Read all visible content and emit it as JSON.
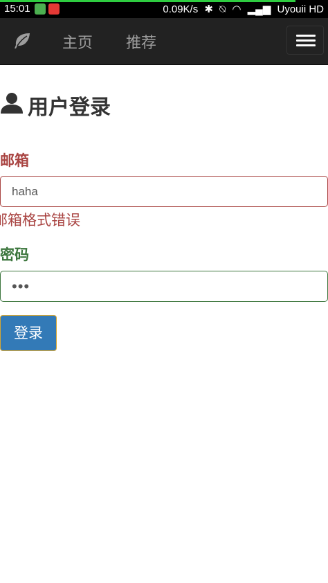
{
  "status_bar": {
    "time": "15:01",
    "net_speed": "0.09K/s",
    "carrier": "Uyouii HD",
    "load_progress": 0.9
  },
  "navbar": {
    "brand_icon": "leaf-icon",
    "links": [
      {
        "label": "主页"
      },
      {
        "label": "推荐"
      }
    ],
    "menu_icon": "hamburger-menu-icon"
  },
  "page": {
    "title_icon": "user-icon",
    "title": "用户登录"
  },
  "form": {
    "email": {
      "label": "邮箱",
      "value": "haha",
      "error": "邮箱格式错误"
    },
    "password": {
      "label": "密码",
      "value": "•••"
    },
    "submit_label": "登录"
  },
  "colors": {
    "navbar_bg": "#222222",
    "error": "#a94442",
    "success": "#3c763d",
    "primary": "#337ab7"
  }
}
